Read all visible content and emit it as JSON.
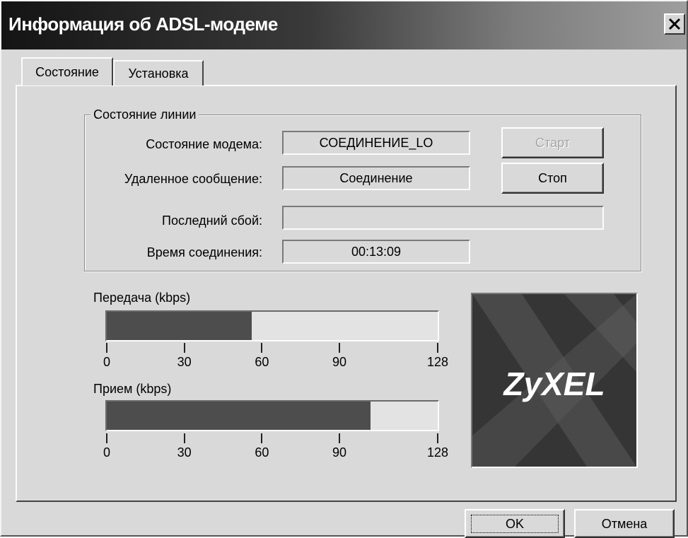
{
  "window": {
    "title": "Информация об ADSL-модеме"
  },
  "tabs": [
    {
      "label": "Состояние",
      "active": true
    },
    {
      "label": "Установка",
      "active": false
    }
  ],
  "line_status": {
    "group_label": "Состояние линии",
    "modem_state_label": "Состояние модема:",
    "modem_state_value": "СОЕДИНЕНИЕ_LO",
    "remote_message_label": "Удаленное сообщение:",
    "remote_message_value": "Соединение",
    "last_failure_label": "Последний сбой:",
    "last_failure_value": "",
    "connection_time_label": "Время соединения:",
    "connection_time_value": "00:13:09",
    "start_label": "Старт",
    "stop_label": "Стоп"
  },
  "meters": {
    "tick_labels": [
      "0",
      "30",
      "60",
      "90",
      "128"
    ],
    "max": 128,
    "transmit": {
      "label": "Передача (kbps)",
      "value": 56
    },
    "receive": {
      "label": "Прием (kbps)",
      "value": 102
    }
  },
  "logo": {
    "text": "ZyXEL"
  },
  "footer": {
    "ok_label": "OK",
    "cancel_label": "Отмена"
  },
  "colors": {
    "bar_fill": "#4d4d4d",
    "dialog_bg": "#d9d9d9",
    "logo_bg": "#353535"
  },
  "icons": {
    "close": "close-icon"
  }
}
